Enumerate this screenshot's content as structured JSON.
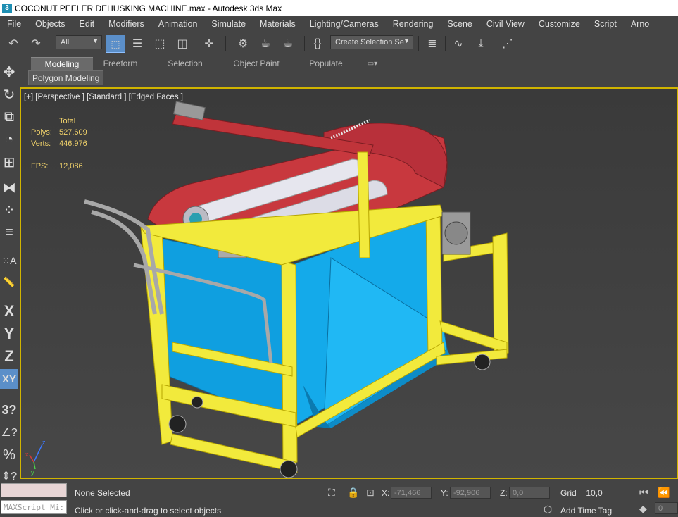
{
  "window": {
    "title": "COCONUT PEELER DEHUSKING MACHINE.max - Autodesk 3ds Max",
    "app_icon": "3"
  },
  "menu": [
    "File",
    "Objects",
    "Edit",
    "Modifiers",
    "Animation",
    "Simulate",
    "Materials",
    "Lighting/Cameras",
    "Rendering",
    "Scene",
    "Civil View",
    "Customize",
    "Script",
    "Arno"
  ],
  "toolbar": {
    "filter_value": "All",
    "selection_set_value": "Create Selection Se"
  },
  "ribbon": {
    "tabs": [
      "Modeling",
      "Freeform",
      "Selection",
      "Object Paint",
      "Populate"
    ],
    "active_tab": "Modeling",
    "panel_button": "Polygon Modeling"
  },
  "left_toolbar": {
    "letters": [
      "X",
      "Y",
      "Z",
      "XY"
    ]
  },
  "viewport": {
    "label": "[+] [Perspective ] [Standard ] [Edged Faces ]",
    "stats": {
      "header": "Total",
      "polys_label": "Polys:",
      "polys_value": "527.609",
      "verts_label": "Verts:",
      "verts_value": "446.976",
      "fps_label": "FPS:",
      "fps_value": "12,086"
    },
    "axis": {
      "x": "x",
      "y": "y",
      "z": "z"
    }
  },
  "status": {
    "maxscript": "MAXScript Mi:",
    "selection": "None Selected",
    "prompt": "Click or click-and-drag to select objects",
    "x_label": "X:",
    "x_value": "-71,466",
    "y_label": "Y:",
    "y_value": "-92,906",
    "z_label": "Z:",
    "z_value": "0,0",
    "grid": "Grid = 10,0",
    "add_time_tag": "Add Time Tag",
    "frame_value": "0"
  },
  "colors": {
    "accent": "#5b8fc9",
    "viewport_border": "#d0b400",
    "frame_yellow": "#f2ea3c",
    "panel_blue": "#10a6e6",
    "cover_red": "#c8383e"
  }
}
